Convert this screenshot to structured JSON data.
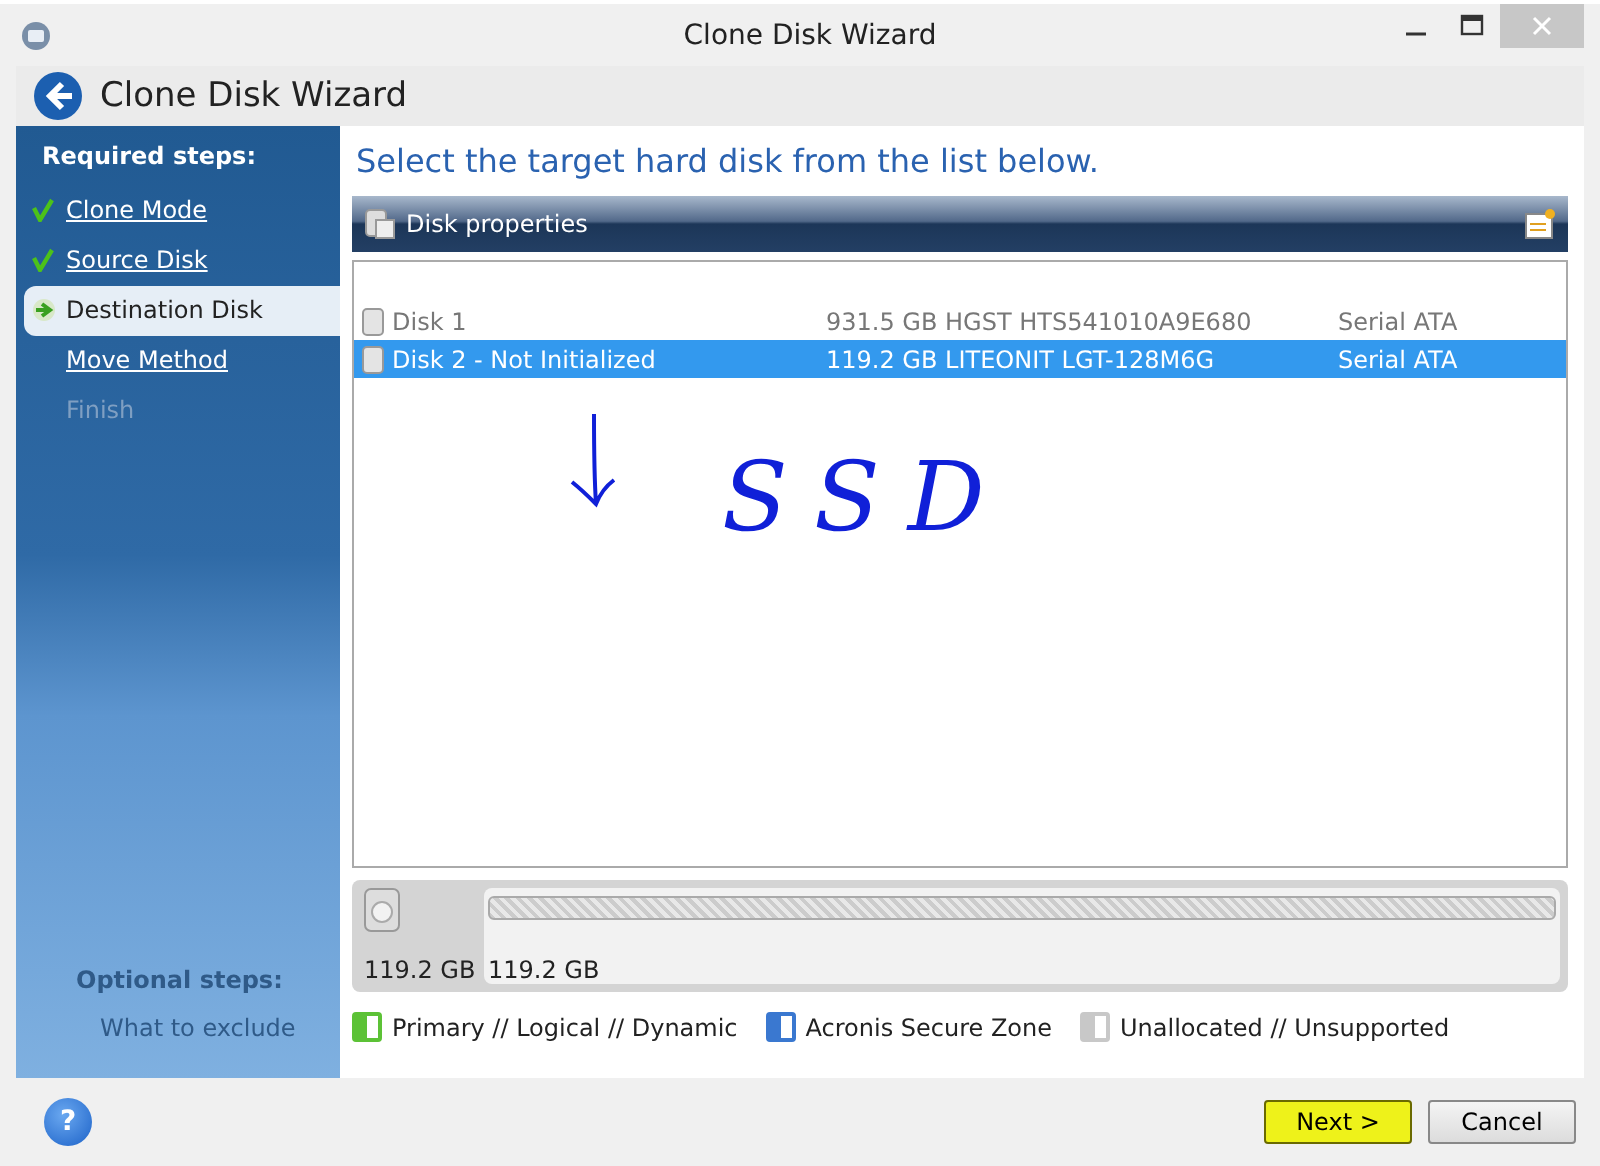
{
  "window": {
    "title": "Clone Disk Wizard"
  },
  "header": {
    "title": "Clone Disk Wizard"
  },
  "sidebar": {
    "required_heading": "Required steps:",
    "steps": [
      {
        "label": "Clone Mode",
        "kind": "done",
        "selected": false
      },
      {
        "label": "Source Disk",
        "kind": "done",
        "selected": false
      },
      {
        "label": "Destination Disk",
        "kind": "current",
        "selected": true
      },
      {
        "label": "Move Method",
        "kind": "pending",
        "selected": false
      },
      {
        "label": "Finish",
        "kind": "disabled",
        "selected": false
      }
    ],
    "optional_heading": "Optional steps:",
    "optional_steps": [
      {
        "label": "What to exclude"
      }
    ]
  },
  "instruction": "Select the target hard disk from the list below.",
  "toolbar": {
    "label": "Disk properties"
  },
  "disks": [
    {
      "name": "Disk 1",
      "details": "931.5 GB HGST HTS541010A9E680",
      "interface": "Serial ATA",
      "selected": false
    },
    {
      "name": "Disk 2 - Not Initialized",
      "details": "119.2 GB LITEONIT LGT-128M6G",
      "interface": "Serial ATA",
      "selected": true
    }
  ],
  "annotation": {
    "text": "SSD"
  },
  "disk_map": {
    "capacity": "119.2 GB",
    "partition_size": "119.2 GB"
  },
  "legend": [
    {
      "label": "Primary // Logical // Dynamic",
      "color": "#5cc236"
    },
    {
      "label": "Acronis Secure Zone",
      "color": "#3a78d0"
    },
    {
      "label": "Unallocated // Unsupported",
      "color": "#c8c8c8"
    }
  ],
  "help": {
    "label": "?"
  },
  "buttons": [
    {
      "label": "Next >",
      "highlighted": true
    },
    {
      "label": "Cancel",
      "highlighted": false
    }
  ]
}
